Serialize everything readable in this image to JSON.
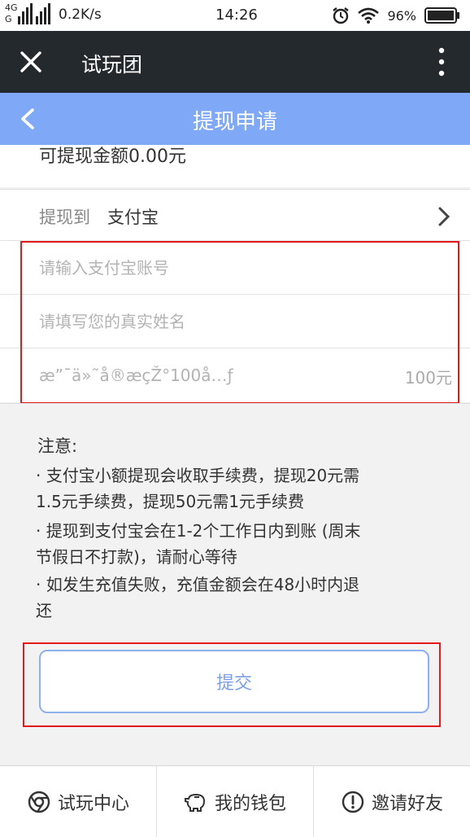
{
  "status_bar": {
    "network_top": "4G",
    "network_bottom": "G",
    "speed": "0.2K/s",
    "time": "14:26",
    "battery": "96%",
    "icons": [
      "signal-icon",
      "alarm-icon",
      "wifi-icon",
      "battery-icon"
    ]
  },
  "title_bar": {
    "title": "试玩团"
  },
  "nav": {
    "title": "提现申请"
  },
  "balance": {
    "text": "可提现金额0.00元"
  },
  "withdraw_to": {
    "label": "提现到",
    "value": "支付宝"
  },
  "form": {
    "account_placeholder": "请输入支付宝账号",
    "name_placeholder": "请填写您的真实姓名",
    "amount_placeholder": "æ”¯ä»˜å®æçŽ°100å…ƒ",
    "amount_unit": "100元"
  },
  "notes": {
    "title": "注意:",
    "lines": [
      "· 支付宝小额提现会收取手续费，提现20元需",
      "1.5元手续费，提现50元需1元手续费",
      "· 提现到支付宝会在1-2个工作日内到账 (周末",
      "节假日不打款)，请耐心等待",
      "· 如发生充值失败，充值金额会在48小时内退",
      "还"
    ]
  },
  "submit": {
    "label": "提交"
  },
  "tabs": [
    {
      "label": "试玩中心",
      "icon": "chrome-icon"
    },
    {
      "label": "我的钱包",
      "icon": "piggy-bank-icon"
    },
    {
      "label": "邀请好友",
      "icon": "alert-circle-icon"
    }
  ],
  "colors": {
    "nav_bg": "#7fa9f7",
    "title_bg": "#24292d",
    "highlight": "#e41919",
    "button_border": "#8fb0ef"
  }
}
